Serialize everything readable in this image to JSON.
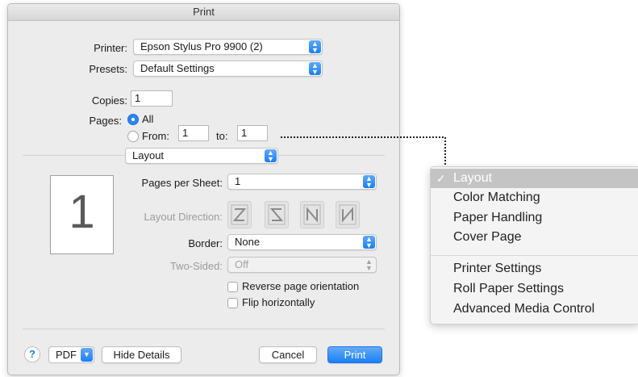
{
  "window": {
    "title": "Print"
  },
  "printer": {
    "label": "Printer:",
    "value": "Epson Stylus Pro 9900 (2)"
  },
  "presets": {
    "label": "Presets:",
    "value": "Default Settings"
  },
  "copies": {
    "label": "Copies:",
    "value": "1"
  },
  "pages": {
    "label": "Pages:",
    "all_label": "All",
    "from_label": "From:",
    "from_value": "1",
    "to_label": "to:",
    "to_value": "1"
  },
  "section_popup": {
    "value": "Layout"
  },
  "layout": {
    "pages_per_sheet_label": "Pages per Sheet:",
    "pages_per_sheet_value": "1",
    "layout_direction_label": "Layout Direction:",
    "border_label": "Border:",
    "border_value": "None",
    "two_sided_label": "Two-Sided:",
    "two_sided_value": "Off",
    "reverse_label": "Reverse page orientation",
    "flip_label": "Flip horizontally",
    "preview_number": "1"
  },
  "footer": {
    "help": "?",
    "pdf": "PDF",
    "hide_details": "Hide Details",
    "cancel": "Cancel",
    "print": "Print"
  },
  "menu": {
    "items": [
      "Layout",
      "Color Matching",
      "Paper Handling",
      "Cover Page",
      "Printer Settings",
      "Roll Paper Settings",
      "Advanced Media Control"
    ],
    "checkmark": "✓"
  },
  "icons": [
    "chevron-updown-icon",
    "chevron-down-icon",
    "checkmark-icon",
    "help-icon"
  ],
  "colors": {
    "accent": "#1a7ff3",
    "menu_selected": "#c4c4c4",
    "dialog_bg": "#ececec"
  }
}
